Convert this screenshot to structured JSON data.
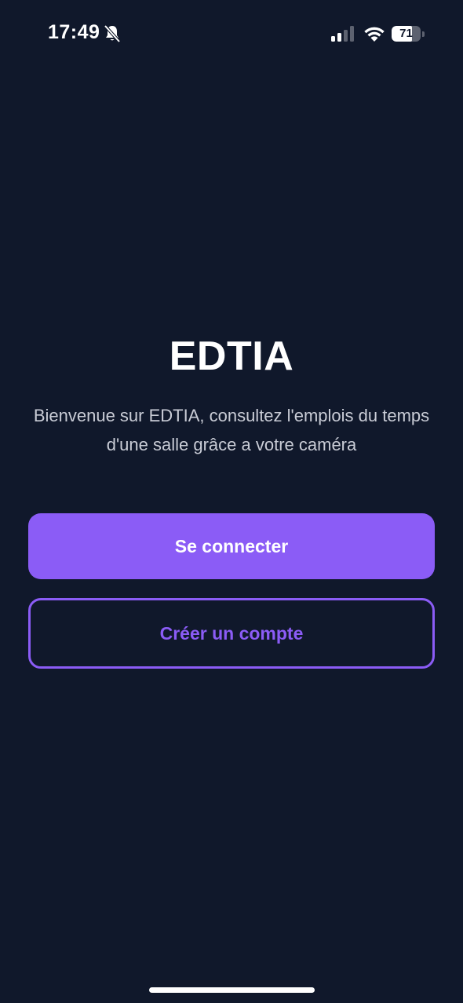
{
  "status_bar": {
    "time": "17:49",
    "battery_level": "71",
    "battery_fraction": 0.71,
    "icons": [
      "bell-slash-icon",
      "cellular-signal-icon",
      "wifi-icon",
      "battery-icon"
    ]
  },
  "welcome": {
    "title": "EDTIA",
    "description": "Bienvenue sur EDTIA, consultez l'emplois du temps d'une salle grâce a votre caméra"
  },
  "actions": {
    "login_label": "Se connecter",
    "signup_label": "Créer un compte"
  },
  "colors": {
    "background": "#10182b",
    "accent": "#8b5cf6",
    "text_primary": "#ffffff",
    "text_secondary": "#c9ccd6"
  }
}
